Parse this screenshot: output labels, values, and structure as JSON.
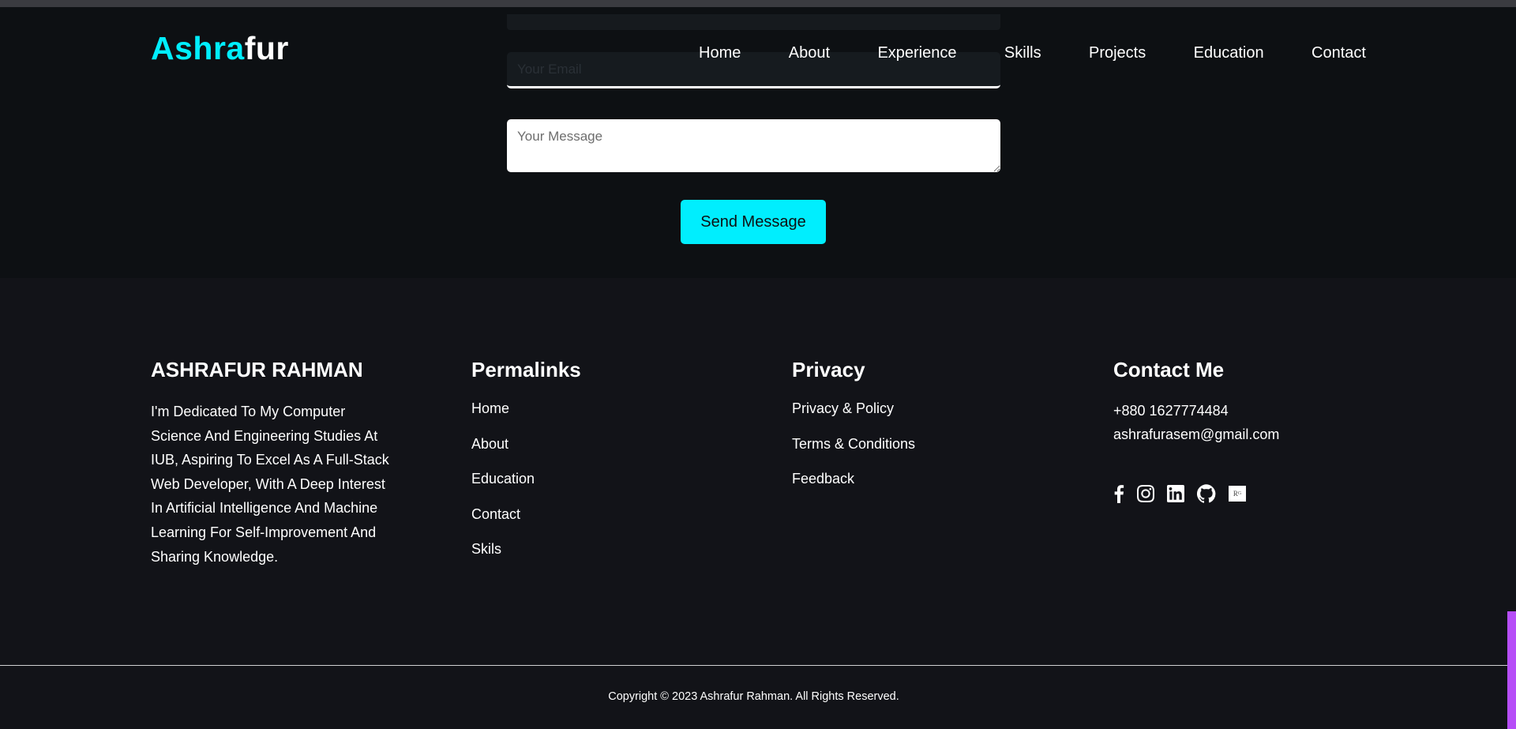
{
  "brand": {
    "logo_part1": "Ashra",
    "logo_part2": "fur",
    "accent": "#00eefe"
  },
  "nav": {
    "items": [
      {
        "label": "Home"
      },
      {
        "label": "About"
      },
      {
        "label": "Experience"
      },
      {
        "label": "Skills"
      },
      {
        "label": "Projects"
      },
      {
        "label": "Education"
      },
      {
        "label": "Contact"
      }
    ]
  },
  "contact_form": {
    "email_placeholder": "Your Email",
    "message_placeholder": "Your Message",
    "send_label": "Send Message"
  },
  "footer": {
    "about": {
      "title": "ASHRAFUR RAHMAN",
      "text": "I'm Dedicated To My Computer Science And Engineering Studies At IUB, Aspiring To Excel As A Full-Stack Web Developer, With A Deep Interest In Artificial Intelligence And Machine Learning For Self-Improvement And Sharing Knowledge."
    },
    "permalinks": {
      "title": "Permalinks",
      "items": [
        {
          "label": "Home"
        },
        {
          "label": "About"
        },
        {
          "label": "Education"
        },
        {
          "label": "Contact"
        },
        {
          "label": "Skils"
        }
      ]
    },
    "privacy": {
      "title": "Privacy",
      "items": [
        {
          "label": "Privacy & Policy"
        },
        {
          "label": "Terms & Conditions"
        },
        {
          "label": "Feedback"
        }
      ]
    },
    "contact": {
      "title": "Contact Me",
      "phone": "+880 1627774484",
      "email": "ashrafurasem@gmail.com",
      "social_icons": [
        "facebook-icon",
        "instagram-icon",
        "linkedin-icon",
        "github-icon",
        "researchgate-icon"
      ]
    },
    "copyright": "Copyright © 2023 Ashrafur Rahman. All Rights Reserved."
  },
  "colors": {
    "scroll_indicator": "#b64ef7",
    "footer_bg": "#121318",
    "section_bg": "#0d1013"
  }
}
